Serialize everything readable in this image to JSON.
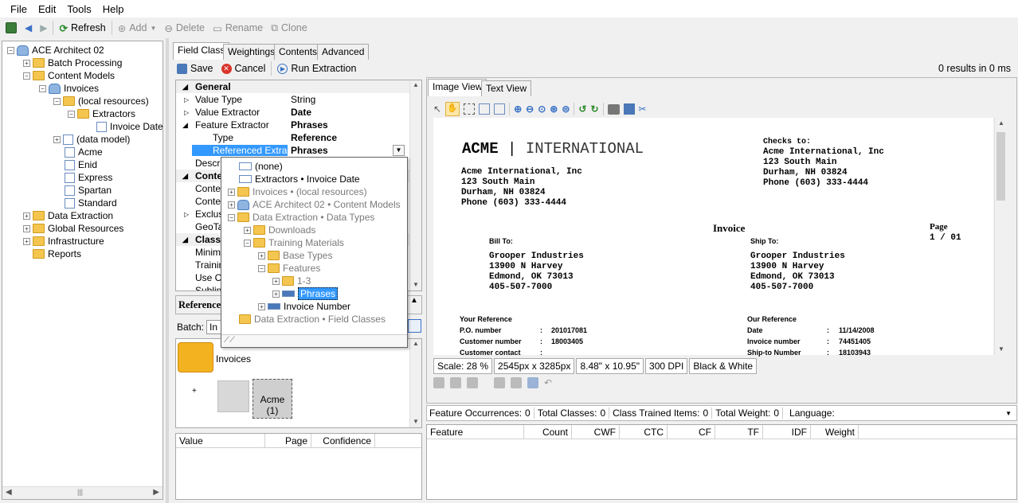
{
  "menu": [
    "File",
    "Edit",
    "Tools",
    "Help"
  ],
  "toolbar": {
    "refresh": "Refresh",
    "add": "Add",
    "delete": "Delete",
    "rename": "Rename",
    "clone": "Clone"
  },
  "tree": {
    "root": "ACE Architect 02",
    "batch": "Batch Processing",
    "content_models": "Content Models",
    "invoices": "Invoices",
    "local": "(local resources)",
    "extractors": "Extractors",
    "invoice_date": "Invoice Date",
    "data_model": "(data model)",
    "acme": "Acme",
    "enid": "Enid",
    "express": "Express",
    "spartan": "Spartan",
    "standard": "Standard",
    "data_extraction": "Data Extraction",
    "global": "Global Resources",
    "infra": "Infrastructure",
    "reports": "Reports"
  },
  "tabs": {
    "field_class": "Field Class",
    "weightings": "Weightings",
    "contents": "Contents",
    "advanced": "Advanced"
  },
  "actions": {
    "save": "Save",
    "cancel": "Cancel",
    "run": "Run Extraction",
    "results": "0 results in 0 ms"
  },
  "props": {
    "general": "General",
    "value_type_k": "Value Type",
    "value_type_v": "String",
    "value_extractor_k": "Value Extractor",
    "value_extractor_v": "Date",
    "feature_extractor_k": "Feature Extractor",
    "feature_extractor_v": "Phrases",
    "type_k": "Type",
    "type_v": "Reference",
    "ref_k": "Referenced Extracto",
    "ref_v": "Phrases",
    "descr": "Descrip",
    "context": "Conte",
    "ctx1": "Contex",
    "ctx2": "Contex",
    "exclus": "Exclusi",
    "geota": "GeoTa",
    "classi": "Classi",
    "minim": "Minimu",
    "trainin": "Trainin",
    "usecl": "Use Cl",
    "sublin": "Sublin"
  },
  "popup": {
    "none": "(none)",
    "extractors": "Extractors",
    "extractors_path": "• Invoice Date",
    "invoices": "Invoices",
    "invoices_path": "• (local resources)",
    "ace": "ACE Architect 02",
    "ace_path": "• Content Models",
    "data_ext": "Data Extraction",
    "data_ext_path": "• Data Types",
    "downloads": "Downloads",
    "training": "Training Materials",
    "base_types": "Base Types",
    "features": "Features",
    "one_three": "1-3",
    "phrases": "Phrases",
    "invoice_number": "Invoice Number",
    "field_classes": "Data Extraction",
    "field_classes_path": "• Field Classes"
  },
  "reference_label": "Reference",
  "batch_label": "Batch:",
  "batch_value": "In",
  "batch_tree": {
    "invoices": "Invoices",
    "acme": "Acme (1)"
  },
  "results_cols": {
    "value": "Value",
    "page": "Page",
    "confidence": "Confidence"
  },
  "view_tabs": {
    "image": "Image View",
    "text": "Text View"
  },
  "document": {
    "brand_bold": "ACME",
    "brand_rest": "INTERNATIONAL",
    "from_name": "Acme International, Inc",
    "from_addr1": "123 South Main",
    "from_addr2": "Durham, NH 03824",
    "from_phone": "Phone (603) 333-4444",
    "checks_to": "Checks to:",
    "ct_name": "Acme International, Inc",
    "ct_addr1": "123 South Main",
    "ct_addr2": "Durham, NH 03824",
    "ct_phone": "Phone (603) 333-4444",
    "title": "Invoice",
    "page_label": "Page",
    "page_value": "1 / 01",
    "bill_to": "Bill To:",
    "ship_to": "Ship To:",
    "b_name": "Grooper Industries",
    "b_addr1": "13900 N Harvey",
    "b_addr2": "Edmond, OK 73013",
    "b_phone": "405-507-7000",
    "s_name": "Grooper Industries",
    "s_addr1": "13900 N Harvey",
    "s_addr2": "Edmond, OK 73013",
    "s_phone": "405-507-7000",
    "your_ref": "Your Reference",
    "po_label": "P.O. number",
    "po_value": "201017081",
    "cust_label": "Customer number",
    "cust_value": "18003405",
    "contact_label": "Customer contact",
    "our_ref": "Our Reference",
    "date_label": "Date",
    "date_value": "11/14/2008",
    "inv_label": "Invoice number",
    "inv_value": "74451405",
    "ship_label": "Ship-to Number",
    "ship_value": "18103943",
    "colon": ":"
  },
  "status": {
    "scale": "Scale: 28 %",
    "px": "2545px x 3285px",
    "inch": "8.48\" x 10.95\"",
    "dpi": "300 DPI",
    "mode": "Black & White"
  },
  "stats": {
    "fo": "Feature Occurrences:",
    "fo_v": "0",
    "tc": "Total Classes:",
    "tc_v": "0",
    "cti": "Class Trained Items:",
    "cti_v": "0",
    "tw": "Total Weight:",
    "tw_v": "0",
    "lang": "Language:"
  },
  "feature_cols": [
    "Feature",
    "Count",
    "CWF",
    "CTC",
    "CF",
    "TF",
    "IDF",
    "Weight"
  ]
}
